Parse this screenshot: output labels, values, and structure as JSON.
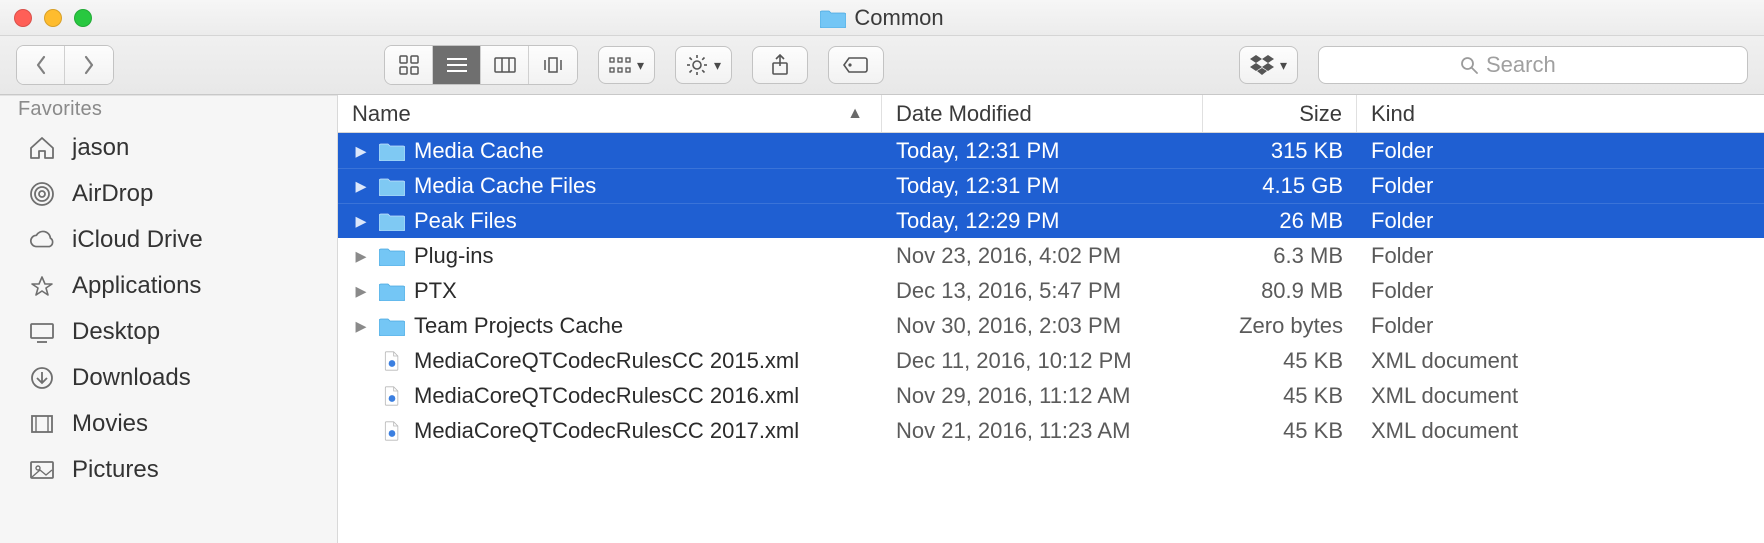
{
  "window": {
    "title": "Common"
  },
  "search": {
    "placeholder": "Search"
  },
  "sidebar": {
    "header": "Favorites",
    "items": [
      {
        "label": "jason",
        "icon": "home-icon"
      },
      {
        "label": "AirDrop",
        "icon": "airdrop-icon"
      },
      {
        "label": "iCloud Drive",
        "icon": "cloud-icon"
      },
      {
        "label": "Applications",
        "icon": "apps-icon"
      },
      {
        "label": "Desktop",
        "icon": "desktop-icon"
      },
      {
        "label": "Downloads",
        "icon": "downloads-icon"
      },
      {
        "label": "Movies",
        "icon": "movies-icon"
      },
      {
        "label": "Pictures",
        "icon": "pictures-icon"
      }
    ]
  },
  "columns": {
    "name": "Name",
    "date": "Date Modified",
    "size": "Size",
    "kind": "Kind",
    "sort_indicator": "^"
  },
  "rows": [
    {
      "name": "Media Cache",
      "date": "Today, 12:31 PM",
      "size": "315 KB",
      "kind": "Folder",
      "type": "folder",
      "selected": true,
      "expandable": true
    },
    {
      "name": "Media Cache Files",
      "date": "Today, 12:31 PM",
      "size": "4.15 GB",
      "kind": "Folder",
      "type": "folder",
      "selected": true,
      "expandable": true
    },
    {
      "name": "Peak Files",
      "date": "Today, 12:29 PM",
      "size": "26 MB",
      "kind": "Folder",
      "type": "folder",
      "selected": true,
      "expandable": true
    },
    {
      "name": "Plug-ins",
      "date": "Nov 23, 2016, 4:02 PM",
      "size": "6.3 MB",
      "kind": "Folder",
      "type": "folder",
      "selected": false,
      "expandable": true
    },
    {
      "name": "PTX",
      "date": "Dec 13, 2016, 5:47 PM",
      "size": "80.9 MB",
      "kind": "Folder",
      "type": "folder",
      "selected": false,
      "expandable": true
    },
    {
      "name": "Team Projects Cache",
      "date": "Nov 30, 2016, 2:03 PM",
      "size": "Zero bytes",
      "kind": "Folder",
      "type": "folder",
      "selected": false,
      "expandable": true
    },
    {
      "name": "MediaCoreQTCodecRulesCC 2015.xml",
      "date": "Dec 11, 2016, 10:12 PM",
      "size": "45 KB",
      "kind": "XML document",
      "type": "xml",
      "selected": false,
      "expandable": false
    },
    {
      "name": "MediaCoreQTCodecRulesCC 2016.xml",
      "date": "Nov 29, 2016, 11:12 AM",
      "size": "45 KB",
      "kind": "XML document",
      "type": "xml",
      "selected": false,
      "expandable": false
    },
    {
      "name": "MediaCoreQTCodecRulesCC 2017.xml",
      "date": "Nov 21, 2016, 11:23 AM",
      "size": "45 KB",
      "kind": "XML document",
      "type": "xml",
      "selected": false,
      "expandable": false
    }
  ]
}
